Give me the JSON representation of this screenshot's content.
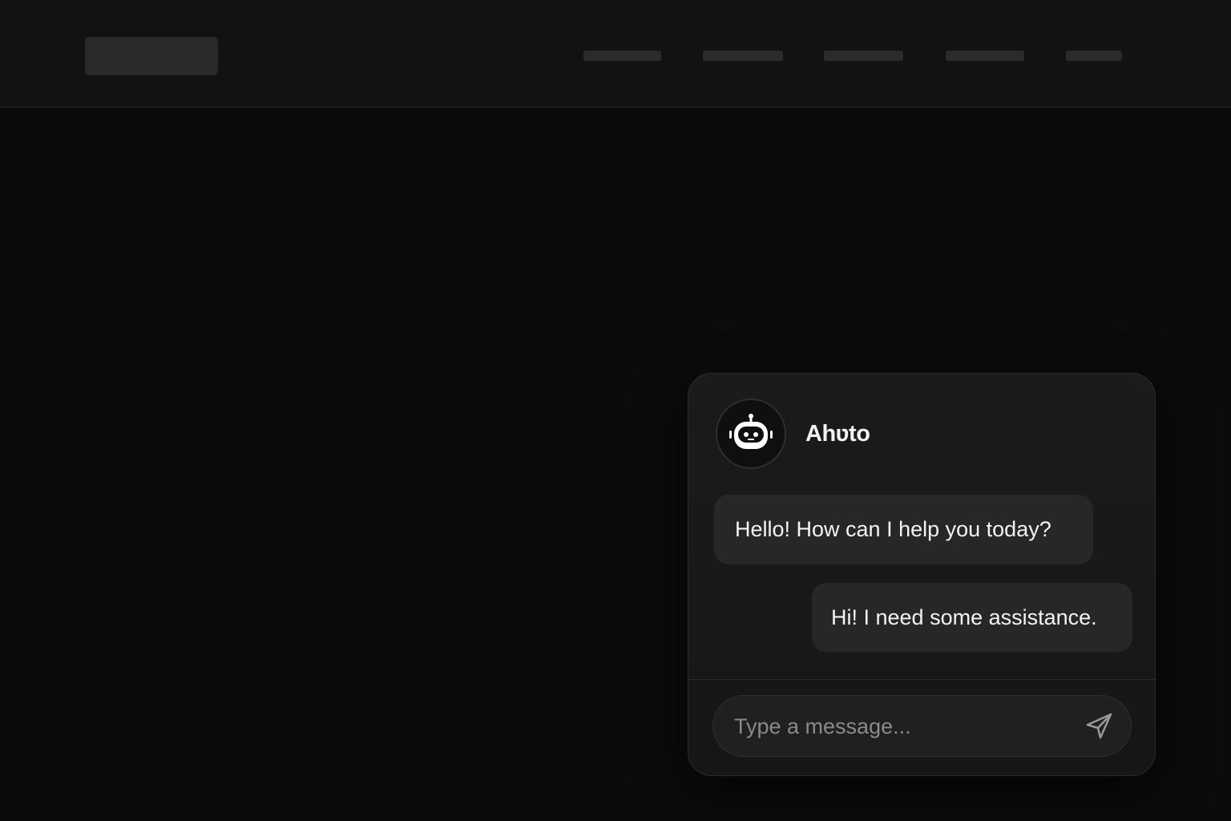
{
  "chat": {
    "bot_name": "Ahʋto",
    "avatar_icon": "robot-icon",
    "messages": [
      {
        "sender": "bot",
        "text": "Hello! How can I help you today?"
      },
      {
        "sender": "user",
        "text": "Hi! I need some assistance."
      }
    ],
    "composer": {
      "placeholder": "Type a message...",
      "value": "",
      "send_icon": "send-icon"
    }
  },
  "colors": {
    "background": "#0b0b0b",
    "topbar": "#121212",
    "panel": "#1b1b1d",
    "bubble": "#27272a",
    "text": "#f3f3f3"
  }
}
